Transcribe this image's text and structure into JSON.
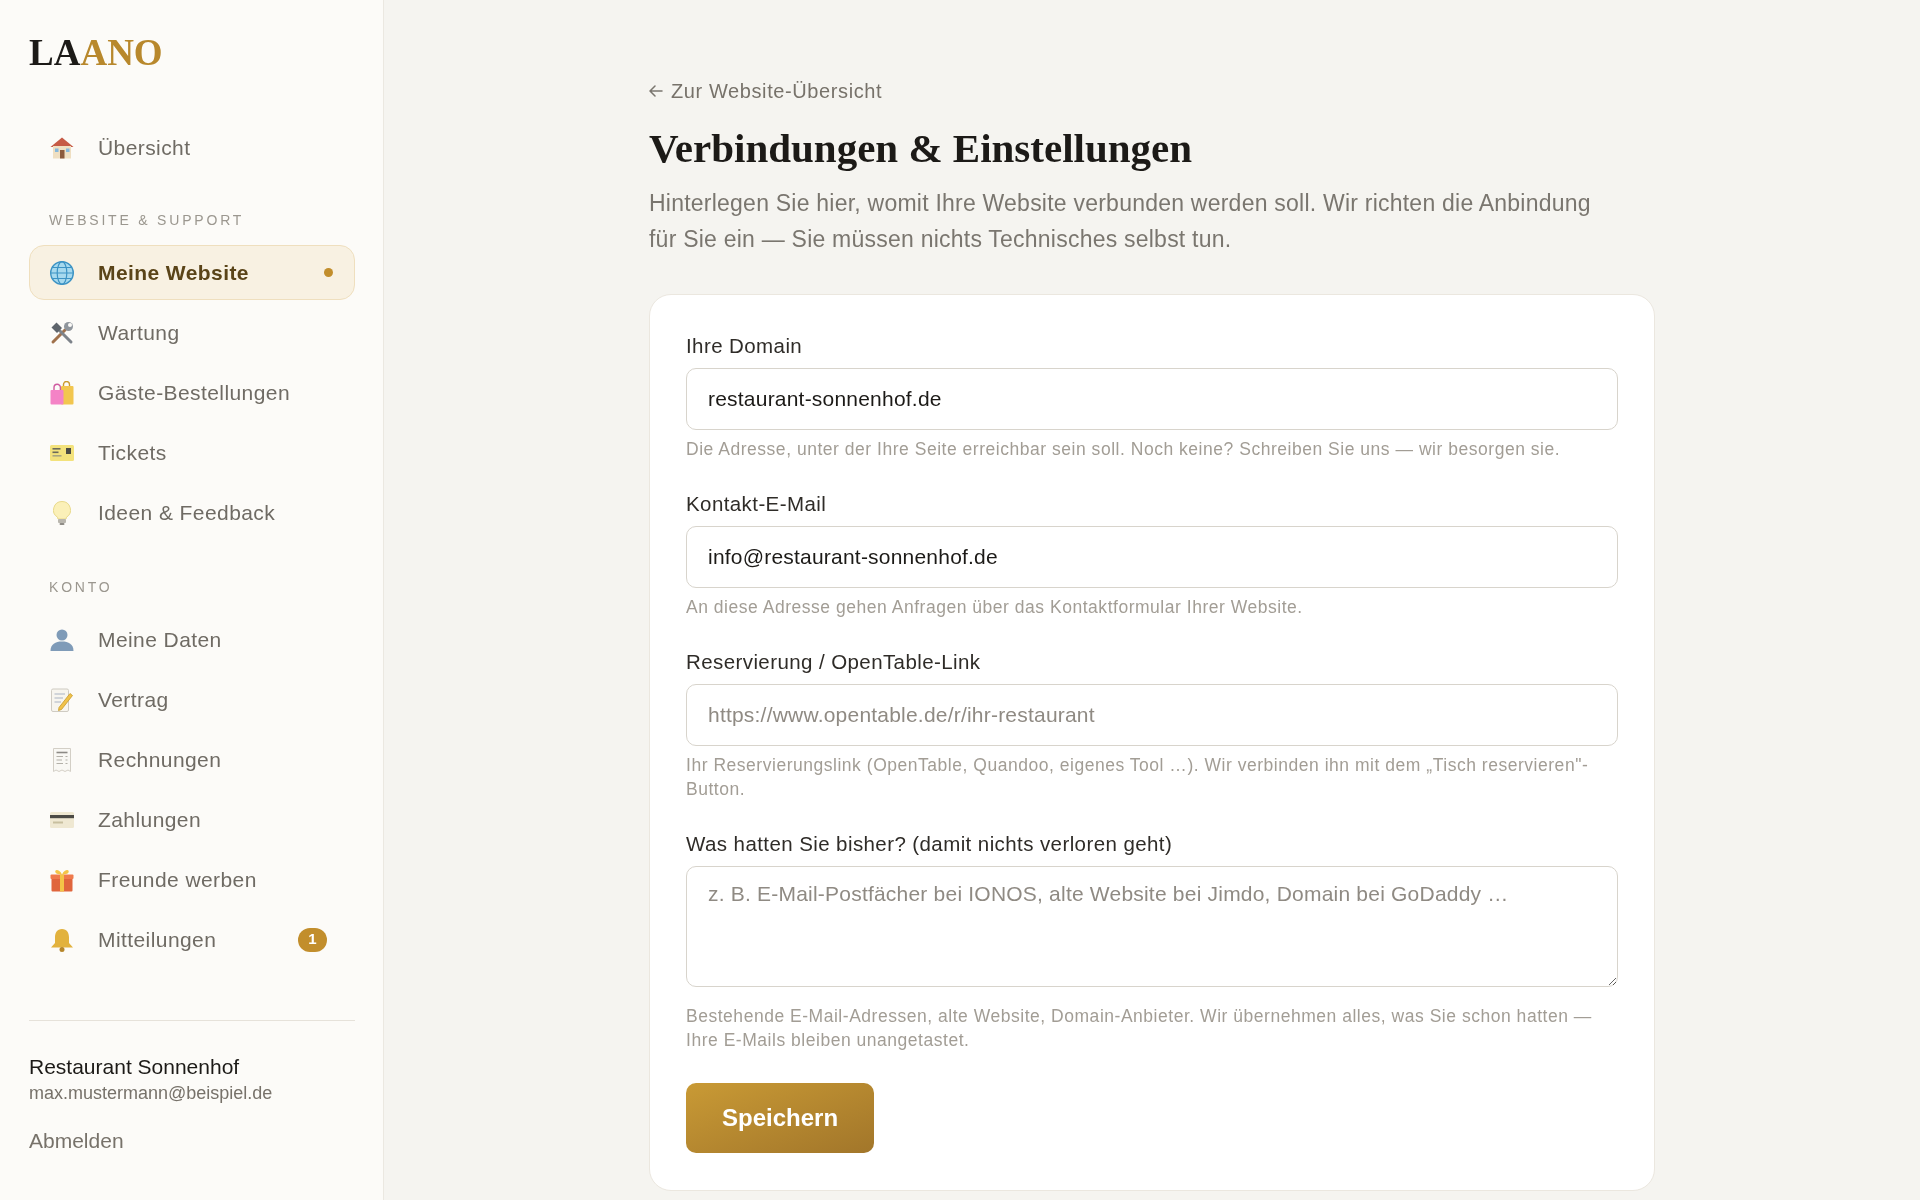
{
  "sidebar": {
    "logo": {
      "dark": "LA",
      "accent": "ANO"
    },
    "groups": [
      {
        "items": [
          {
            "label": "Übersicht",
            "selected": false
          }
        ]
      },
      {
        "heading": "WEBSITE & SUPPORT",
        "items": [
          {
            "label": "Meine Website",
            "selected": true
          },
          {
            "label": "Wartung",
            "selected": false
          },
          {
            "label": "Gäste-Bestellungen",
            "selected": false
          },
          {
            "label": "Tickets",
            "selected": false
          },
          {
            "label": "Ideen & Feedback",
            "selected": false
          }
        ]
      },
      {
        "heading": "KONTO",
        "items": [
          {
            "label": "Meine Daten",
            "selected": false
          },
          {
            "label": "Vertrag",
            "selected": false
          },
          {
            "label": "Rechnungen",
            "selected": false
          },
          {
            "label": "Zahlungen",
            "selected": false
          },
          {
            "label": "Freunde werben",
            "selected": false
          },
          {
            "label": "Mitteilungen",
            "selected": false,
            "badge": "1"
          }
        ]
      }
    ],
    "account": {
      "name": "Restaurant Sonnenhof",
      "email": "max.mustermann@beispiel.de"
    },
    "logout": "Abmelden"
  },
  "main": {
    "back_link": "Zur Website-Übersicht",
    "title": "Verbindungen & Einstellungen",
    "intro": "Hinterlegen Sie hier, womit Ihre Website verbunden werden soll. Wir richten die Anbindung für Sie ein — Sie müssen nichts Technisches selbst tun.",
    "form": {
      "fields": [
        {
          "kind": "input",
          "label": "Ihre Domain",
          "value": "restaurant-sonnenhof.de",
          "help": "Die Adresse, unter der Ihre Seite erreichbar sein soll. Noch keine? Schreiben Sie uns — wir besorgen sie."
        },
        {
          "kind": "input",
          "label": "Kontakt-E-Mail",
          "value": "info@restaurant-sonnenhof.de",
          "help": "An diese Adresse gehen Anfragen über das Kontaktformular Ihrer Website."
        },
        {
          "kind": "input",
          "label": "Reservierung / OpenTable-Link",
          "placeholder": "https://www.opentable.de/r/ihr-restaurant",
          "help": "Ihr Reservierungslink (OpenTable, Quandoo, eigenes Tool …). Wir verbinden ihn mit dem „Tisch reservieren\"-Button."
        },
        {
          "kind": "textarea",
          "label": "Was hatten Sie bisher? (damit nichts verloren geht)",
          "placeholder": "z. B. E-Mail-Postfächer bei IONOS, alte Website bei Jimdo, Domain bei GoDaddy …",
          "help": "Bestehende E-Mail-Adressen, alte Website, Domain-Anbieter. Wir übernehmen alles, was Sie schon hatten — Ihre E-Mails bleiben unangetastet."
        }
      ],
      "submit": "Speichern"
    }
  }
}
